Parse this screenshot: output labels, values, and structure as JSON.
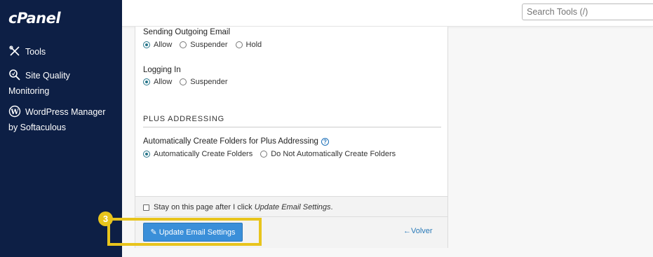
{
  "sidebar": {
    "logo": "cPanel",
    "items": [
      {
        "label": "Tools",
        "icon": "tools-icon"
      },
      {
        "label_line1": "Site Quality",
        "label_line2": "Monitoring",
        "icon": "magnifier-icon"
      },
      {
        "label_line1": "WordPress Manager",
        "label_line2": "by Softaculous",
        "icon": "wordpress-icon"
      }
    ]
  },
  "topbar": {
    "search_placeholder": "Search Tools (/)"
  },
  "settings": {
    "sending": {
      "label": "Sending Outgoing Email",
      "options": [
        "Allow",
        "Suspender",
        "Hold"
      ],
      "selected": "Allow"
    },
    "logging": {
      "label": "Logging In",
      "options": [
        "Allow",
        "Suspender"
      ],
      "selected": "Allow"
    },
    "plus": {
      "section_title": "PLUS ADDRESSING",
      "label": "Automatically Create Folders for Plus Addressing",
      "options": [
        "Automatically Create Folders",
        "Do Not Automatically Create Folders"
      ],
      "selected": "Automatically Create Folders"
    }
  },
  "footer": {
    "stay_prefix": "Stay on this page after I click ",
    "stay_italic": "Update Email Settings",
    "stay_suffix": ".",
    "update_button": "Update Email Settings",
    "back_link": "Volver"
  },
  "annotation": {
    "step_number": "3",
    "color": "#e8c41c"
  },
  "colors": {
    "sidebar_bg": "#0d1f45",
    "accent_radio": "#26758a",
    "button_blue": "#3a8fd9",
    "link_blue": "#2a7ab8"
  }
}
